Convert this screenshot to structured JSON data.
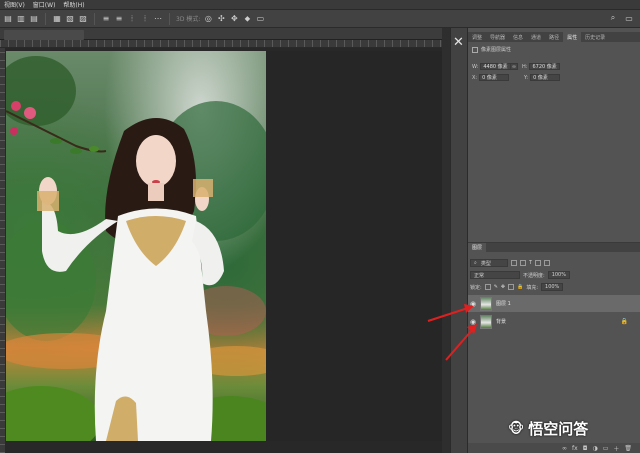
{
  "menu": [
    "视图(V)",
    "窗口(W)",
    "帮助(H)"
  ],
  "options_bar": {
    "text": "3D 模式:",
    "icons": [
      "align-left-icon",
      "align-center-icon",
      "align-right-icon",
      "align-top-icon",
      "align-middle-icon",
      "align-bottom-icon",
      "distribute-icon",
      "distribute-icon",
      "distribute-icon",
      "distribute-icon",
      "more-icon"
    ],
    "right_icons": [
      "search-icon",
      "workspace-icon"
    ]
  },
  "properties_panel": {
    "tabs": [
      "调整",
      "导航器",
      "信息",
      "通道",
      "路径",
      "属性",
      "历史记录"
    ],
    "active_tab": "属性",
    "title": "像素图层属性",
    "w_label": "W:",
    "w_value": "4480 像素",
    "h_label": "H:",
    "h_value": "6720 像素",
    "x_label": "X:",
    "x_value": "0 像素",
    "y_label": "Y:",
    "y_value": "0 像素"
  },
  "layers_panel": {
    "tab": "图层",
    "filter": "类型",
    "blend_mode": "正常",
    "opacity_label": "不透明度:",
    "opacity_value": "100%",
    "lock_label": "锁定:",
    "fill_label": "填充:",
    "fill_value": "100%",
    "layers": [
      {
        "name": "图层 1",
        "visible": true,
        "selected": true,
        "locked": false
      },
      {
        "name": "背景",
        "visible": true,
        "selected": false,
        "locked": true
      }
    ],
    "footer_icons": [
      "link-icon",
      "fx-icon",
      "mask-icon",
      "adjustment-icon",
      "group-icon",
      "new-layer-icon",
      "trash-icon"
    ]
  },
  "annotations": {
    "arrow_color": "#e02020"
  },
  "watermark": "悟空问答"
}
